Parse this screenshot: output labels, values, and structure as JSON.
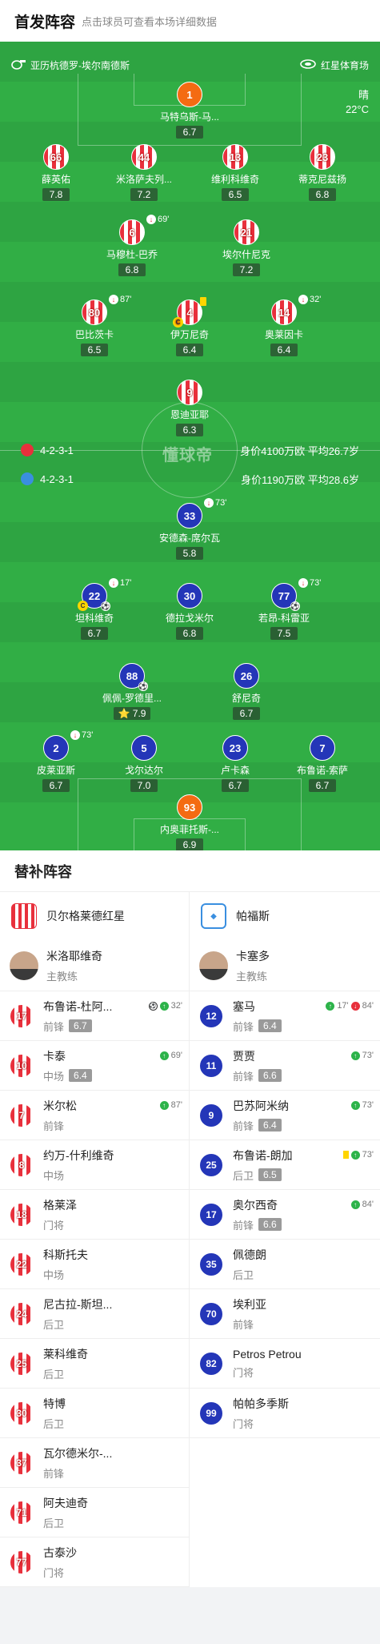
{
  "header": {
    "title": "首发阵容",
    "hint": "点击球员可查看本场详细数据"
  },
  "pitch": {
    "competition": "亚历杭德罗-埃尔南德斯",
    "venue": "红星体育场",
    "weather": "晴",
    "temperature": "22°C",
    "watermark": "懂球帝",
    "home_team_line": {
      "formation": "4-2-3-1",
      "stats": "身价4100万欧 平均26.7岁"
    },
    "away_team_line": {
      "formation": "4-2-3-1",
      "stats": "身价1190万欧 平均28.6岁"
    }
  },
  "home_players": [
    {
      "number": "66",
      "name": "薛英佑",
      "rating": "7.8",
      "event": ""
    },
    {
      "number": "44",
      "name": "米洛萨夫列...",
      "rating": "7.2",
      "event": ""
    },
    {
      "number": "13",
      "name": "维利科维奇",
      "rating": "6.5",
      "event": ""
    },
    {
      "number": "23",
      "name": "蒂克尼兹扬",
      "rating": "6.8",
      "event": ""
    },
    {
      "number": "6",
      "name": "马穆杜-巴乔",
      "rating": "6.8",
      "event": "69'"
    },
    {
      "number": "21",
      "name": "埃尔什尼克",
      "rating": "7.2",
      "event": ""
    },
    {
      "number": "80",
      "name": "巴比茨卡",
      "rating": "6.5",
      "event": "87'"
    },
    {
      "number": "4",
      "name": "伊万尼奇",
      "rating": "6.4",
      "event": ""
    },
    {
      "number": "14",
      "name": "奥莱因卡",
      "rating": "6.4",
      "event": "32'"
    },
    {
      "number": "9",
      "name": "恩迪亚耶",
      "rating": "6.3",
      "event": ""
    }
  ],
  "home_keeper": {
    "number": "1",
    "name": "马特乌斯-马...",
    "rating": "6.7"
  },
  "away_players": [
    {
      "number": "33",
      "name": "安德森-席尔瓦",
      "rating": "5.8",
      "event": "73'"
    },
    {
      "number": "22",
      "name": "坦科维奇",
      "rating": "6.7",
      "event": "17'"
    },
    {
      "number": "30",
      "name": "德拉戈米尔",
      "rating": "6.8",
      "event": ""
    },
    {
      "number": "77",
      "name": "若昂-科雷亚",
      "rating": "7.5",
      "event": "73'"
    },
    {
      "number": "88",
      "name": "佩佩-罗德里...",
      "rating": "7.9",
      "event": ""
    },
    {
      "number": "26",
      "name": "舒尼奇",
      "rating": "6.7",
      "event": ""
    },
    {
      "number": "2",
      "name": "皮莱亚斯",
      "rating": "6.7",
      "event": "73'"
    },
    {
      "number": "5",
      "name": "戈尔达尔",
      "rating": "7.0",
      "event": ""
    },
    {
      "number": "23",
      "name": "卢卡森",
      "rating": "6.7",
      "event": ""
    },
    {
      "number": "7",
      "name": "布鲁诺-索萨",
      "rating": "6.7",
      "event": ""
    }
  ],
  "away_keeper": {
    "number": "93",
    "name": "内奥菲托斯-...",
    "rating": "6.9"
  },
  "subs": {
    "title": "替补阵容",
    "home": {
      "team": "贝尔格莱德红星",
      "coach": {
        "name": "米洛耶维奇",
        "role": "主教练"
      },
      "players": [
        {
          "number": "17",
          "name": "布鲁诺-杜阿...",
          "pos": "前锋",
          "rating": "6.7",
          "event": "32'"
        },
        {
          "number": "10",
          "name": "卡泰",
          "pos": "中场",
          "rating": "6.4",
          "event": "69'"
        },
        {
          "number": "7",
          "name": "米尔松",
          "pos": "前锋",
          "rating": "",
          "event": "87'"
        },
        {
          "number": "8",
          "name": "约万-什利维奇",
          "pos": "中场",
          "rating": "",
          "event": ""
        },
        {
          "number": "18",
          "name": "格莱泽",
          "pos": "门将",
          "rating": "",
          "event": ""
        },
        {
          "number": "22",
          "name": "科斯托夫",
          "pos": "中场",
          "rating": "",
          "event": ""
        },
        {
          "number": "24",
          "name": "尼古拉-斯坦...",
          "pos": "后卫",
          "rating": "",
          "event": ""
        },
        {
          "number": "25",
          "name": "莱科维奇",
          "pos": "后卫",
          "rating": "",
          "event": ""
        },
        {
          "number": "30",
          "name": "特博",
          "pos": "后卫",
          "rating": "",
          "event": ""
        },
        {
          "number": "37",
          "name": "瓦尔德米尔-...",
          "pos": "前锋",
          "rating": "",
          "event": ""
        },
        {
          "number": "71",
          "name": "阿夫迪奇",
          "pos": "后卫",
          "rating": "",
          "event": ""
        },
        {
          "number": "77",
          "name": "古泰沙",
          "pos": "门将",
          "rating": "",
          "event": ""
        }
      ]
    },
    "away": {
      "team": "帕福斯",
      "coach": {
        "name": "卡塞多",
        "role": "主教练"
      },
      "players": [
        {
          "number": "12",
          "name": "塞马",
          "pos": "前锋",
          "rating": "6.4",
          "event_in": "17'",
          "event_out": "84'"
        },
        {
          "number": "11",
          "name": "贾贾",
          "pos": "前锋",
          "rating": "6.6",
          "event_in": "73'",
          "event_out": ""
        },
        {
          "number": "9",
          "name": "巴苏阿米纳",
          "pos": "前锋",
          "rating": "6.4",
          "event_in": "73'",
          "event_out": ""
        },
        {
          "number": "25",
          "name": "布鲁诺-朗加",
          "pos": "后卫",
          "rating": "6.5",
          "event_in": "73'",
          "event_out": ""
        },
        {
          "number": "17",
          "name": "奥尔西奇",
          "pos": "前锋",
          "rating": "6.6",
          "event_in": "84'",
          "event_out": ""
        },
        {
          "number": "35",
          "name": "佩德朗",
          "pos": "后卫",
          "rating": "",
          "event_in": "",
          "event_out": ""
        },
        {
          "number": "70",
          "name": "埃利亚",
          "pos": "前锋",
          "rating": "",
          "event_in": "",
          "event_out": ""
        },
        {
          "number": "82",
          "name": "Petros Petrou",
          "pos": "门将",
          "rating": "",
          "event_in": "",
          "event_out": ""
        },
        {
          "number": "99",
          "name": "帕帕多季斯",
          "pos": "门将",
          "rating": "",
          "event_in": "",
          "event_out": ""
        }
      ]
    }
  }
}
